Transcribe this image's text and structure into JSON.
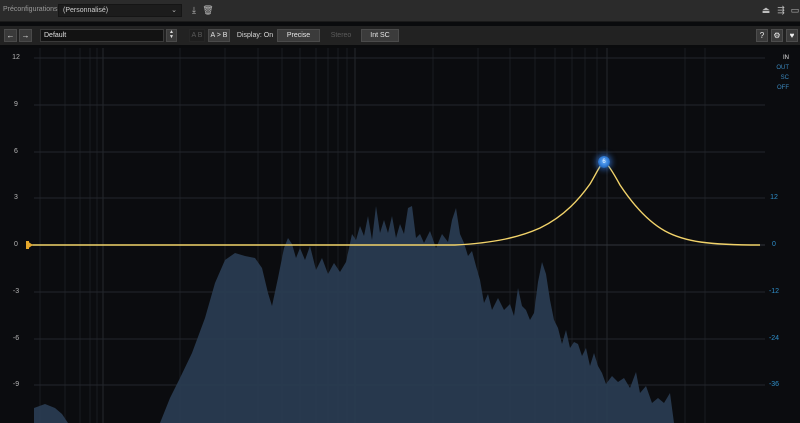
{
  "topbar": {
    "presets_label": "Préconfigurations :",
    "presets_value": "(Personnalisé)",
    "icons": [
      "save-icon",
      "trash-icon",
      "hardware-icon",
      "routing-icon",
      "window-icon"
    ]
  },
  "toolbar": {
    "back_label": "←",
    "forward_label": "→",
    "preset_name": "Default",
    "ab_label": "A B",
    "a_to_b_label": "A > B",
    "display_label": "Display: On",
    "precise_label": "Precise",
    "stereo_label": "Stereo",
    "sidechain_label": "Int SC",
    "help_label": "?",
    "settings_icon": "gear-icon",
    "heart_icon": "heart-icon"
  },
  "graph": {
    "y_left_labels": [
      "12",
      "9",
      "6",
      "3",
      "0",
      "-3",
      "-6",
      "-9"
    ],
    "y_right_labels": [
      "12",
      "0",
      "-12",
      "-24",
      "-36"
    ],
    "legend": [
      "IN",
      "OUT",
      "SC",
      "OFF"
    ],
    "node_label": "6",
    "colors": {
      "curve": "#f2d36a",
      "spectrum": "#2a3d52",
      "node": "#3d8cf0",
      "right_axis": "#2f8ec9"
    }
  }
}
